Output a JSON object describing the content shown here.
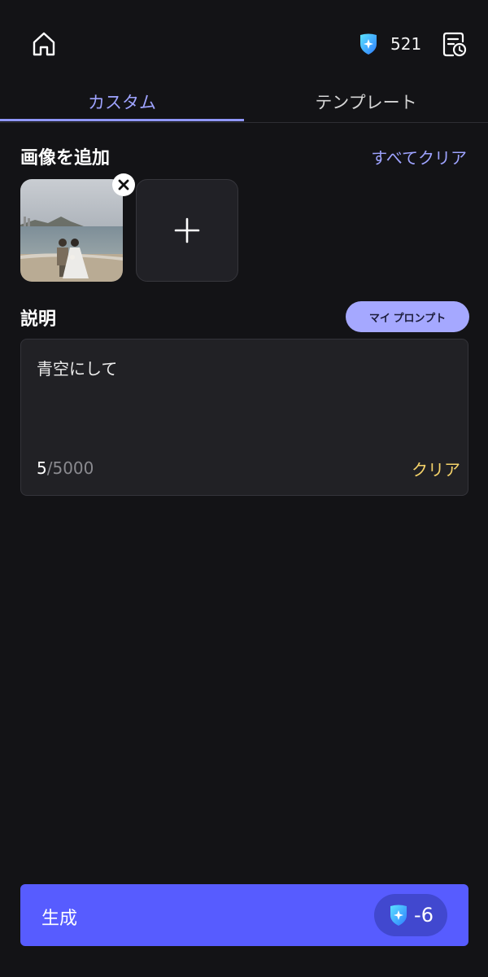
{
  "header": {
    "credits": "521",
    "home_icon": "home-icon",
    "credit_icon": "credit-shield-icon",
    "history_icon": "history-clock-icon"
  },
  "tabs": [
    {
      "label": "カスタム",
      "active": true
    },
    {
      "label": "テンプレート",
      "active": false
    }
  ],
  "images_section": {
    "title": "画像を追加",
    "clear_all": "すべてクリア",
    "images": [
      {
        "alt": "wedding photo thumbnail"
      }
    ]
  },
  "description": {
    "title": "説明",
    "my_prompt": "マイ プロンプト",
    "text": "青空にして",
    "count": "5",
    "max": "/5000",
    "clear": "クリア"
  },
  "generate": {
    "label": "生成",
    "cost": "-6"
  },
  "colors": {
    "background": "#131316",
    "accent": "#575cff",
    "tab_active": "#9ea3ff",
    "clear_yellow": "#f5d36a"
  }
}
